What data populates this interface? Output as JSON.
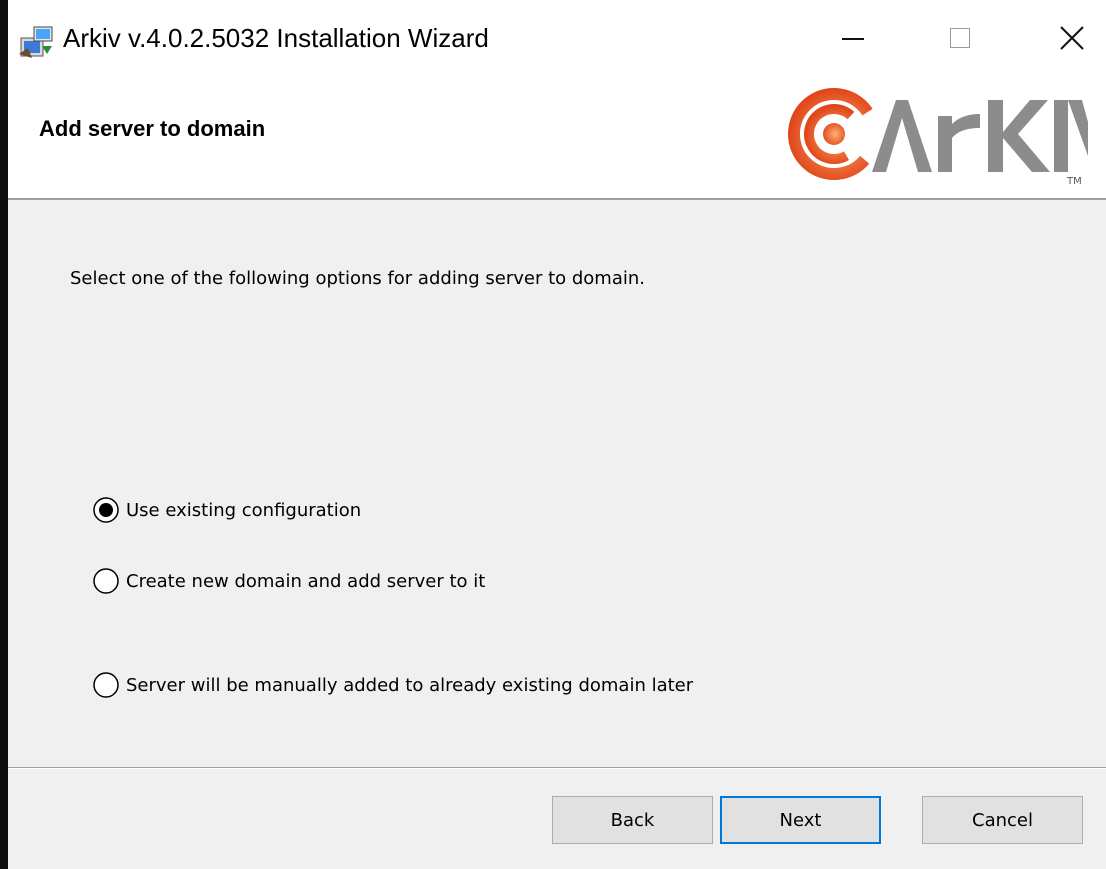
{
  "window": {
    "title": "Arkiv v.4.0.2.5032 Installation Wizard",
    "icon": "installer-icon",
    "controls": [
      "minimize-icon",
      "maximize-icon",
      "close-icon"
    ]
  },
  "header": {
    "title": "Add server to domain",
    "logo_text": "ARKIV",
    "logo_tm": "TM"
  },
  "content": {
    "instruction": "Select one of the following options for adding server to domain.",
    "options": [
      {
        "label": "Use existing configuration",
        "selected": true
      },
      {
        "label": "Create new domain and add server to it",
        "selected": false
      },
      {
        "label": "Server will be manually added to already existing domain later",
        "selected": false
      }
    ]
  },
  "buttons": {
    "back": "Back",
    "next": "Next",
    "cancel": "Cancel"
  },
  "colors": {
    "accent": "#0078d7",
    "logo_orange": "#f05a1e",
    "logo_gray": "#8c8c8c"
  }
}
